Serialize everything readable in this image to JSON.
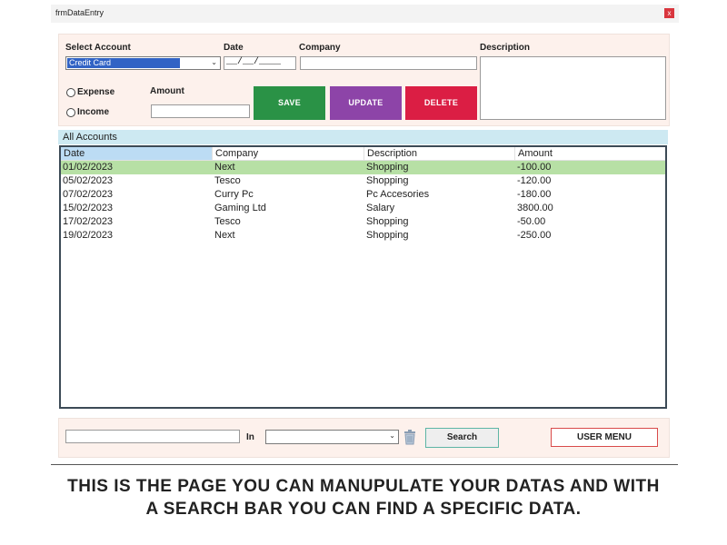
{
  "window": {
    "title": "frmDataEntry",
    "close_label": "x"
  },
  "form": {
    "select_account_label": "Select Account",
    "select_account_value": "Credit Card",
    "date_label": "Date",
    "date_mask": "__/__/____",
    "company_label": "Company",
    "company_value": "",
    "description_label": "Description",
    "description_value": "",
    "expense_label": "Expense",
    "income_label": "Income",
    "amount_label": "Amount",
    "amount_value": "",
    "save_label": "SAVE",
    "update_label": "UPDATE",
    "delete_label": "DELETE"
  },
  "grid": {
    "title": "All Accounts",
    "columns": [
      "Date",
      "Company",
      "Description",
      "Amount"
    ],
    "selected_row": 0,
    "rows": [
      [
        "01/02/2023",
        "Next",
        "Shopping",
        "-100.00"
      ],
      [
        "05/02/2023",
        "Tesco",
        "Shopping",
        "-120.00"
      ],
      [
        "07/02/2023",
        "Curry Pc",
        "Pc Accesories",
        "-180.00"
      ],
      [
        "15/02/2023",
        "Gaming Ltd",
        "Salary",
        "3800.00"
      ],
      [
        "17/02/2023",
        "Tesco",
        "Shopping",
        "-50.00"
      ],
      [
        "19/02/2023",
        "Next",
        "Shopping",
        "-250.00"
      ]
    ]
  },
  "search": {
    "query_value": "",
    "in_label": "In",
    "field_value": "",
    "search_label": "Search",
    "user_menu_label": "USER MENU"
  },
  "caption": {
    "line1": "THIS IS THE PAGE YOU CAN MANUPULATE YOUR DATAS AND WITH",
    "line2": "A SEARCH BAR YOU CAN FIND A SPECIFIC DATA."
  },
  "colors": {
    "save": "#2a9246",
    "update": "#8d44a8",
    "delete": "#db1e44",
    "selected_row": "#b7e0a5",
    "header_selected": "#bcdcf4",
    "panel": "#fdf1ec",
    "grid_header": "#cde9f2"
  },
  "icons": {
    "trash": "trash-icon",
    "dropdown": "chevron-down-icon"
  }
}
